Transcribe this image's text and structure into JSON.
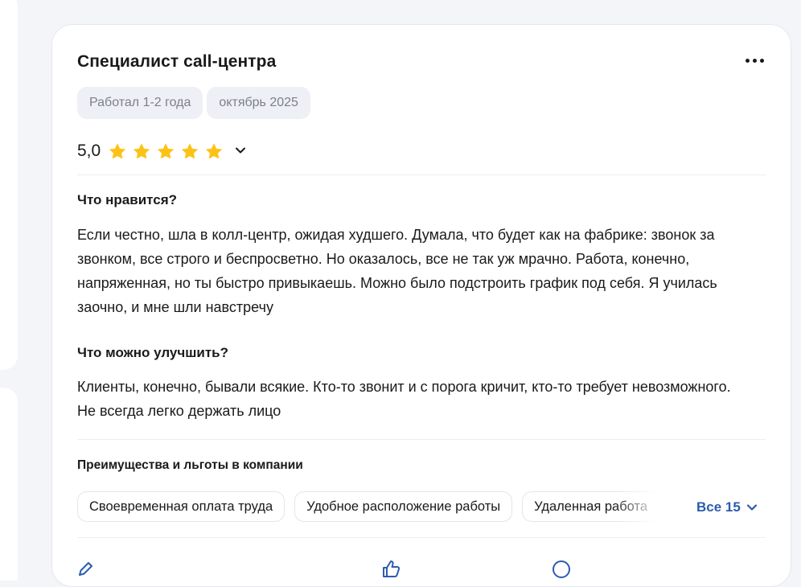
{
  "review": {
    "title": "Специалист call-центра",
    "tags": [
      "Работал 1-2 года",
      "октябрь 2025"
    ],
    "rating": {
      "value_text": "5,0",
      "stars": 5
    },
    "likes_title": "Что нравится?",
    "likes_text": "Если честно, шла в колл-центр, ожидая худшего. Думала, что будет как на фабрике: звонок за звонком, все строго и беспросветно. Но оказалось, все не так уж мрачно. Работа, конечно, напряженная, но ты быстро привыкаешь. Можно было подстроить график под себя. Я училась заочно, и мне шли навстречу",
    "improve_title": "Что можно улучшить?",
    "improve_text": "Клиенты, конечно, бывали всякие. Кто-то звонит и с порога кричит, кто-то требует невозможного. Не всегда легко держать лицо",
    "benefits": {
      "title": "Преимущества и льготы в компании",
      "items": [
        "Своевременная оплата труда",
        "Удобное расположение работы",
        "Удаленная работа"
      ],
      "all_label": "Все 15"
    }
  },
  "colors": {
    "accent_link": "#2b5cae",
    "star": "#fcc216",
    "tag_bg": "#eef0f5",
    "tag_text": "#7d8089"
  },
  "icons": [
    "more-icon",
    "star-icon",
    "chevron-down-icon",
    "pen-icon",
    "thumb-up-icon",
    "comment-icon"
  ]
}
